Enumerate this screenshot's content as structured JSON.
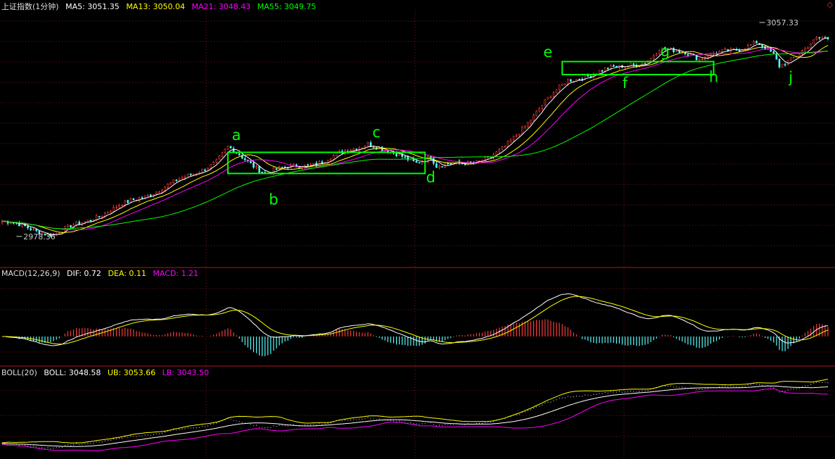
{
  "header_main": {
    "title": "上证指数(1分钟)",
    "ma5": "MA5: 3051.35",
    "ma13": "MA13: 3050.04",
    "ma21": "MA21: 3048.43",
    "ma55": "MA55: 3049.75"
  },
  "header_macd": {
    "title": "MACD(12,26,9)",
    "dif": "DIF: 0.72",
    "dea": "DEA: 0.11",
    "macd": "MACD: 1.21"
  },
  "header_boll": {
    "title": "BOLL(20)",
    "boll": "BOLL: 3048.58",
    "ub": "UB: 3053.66",
    "lb": "LB: 3043.50"
  },
  "corner_icon": "diamond-icon",
  "colors": {
    "background": "#000000",
    "up_candle": "#ff3a3a",
    "down_candle": "#54ffff",
    "ma5": "#ffffff",
    "ma13": "#ffff00",
    "ma21": "#ff00ff",
    "ma55": "#00ff00",
    "annotation": "#00ff00",
    "separator": "#b01818",
    "grid": "#7a1a1a"
  },
  "chart_data": [
    {
      "type": "candlestick",
      "title": "上证指数(1分钟)",
      "ylim": [
        2970,
        3062
      ],
      "price_labels": [
        {
          "text": "3057.33",
          "value": 3057.33,
          "t": 265
        },
        {
          "text": "2978.36",
          "value": 2978.36,
          "t": 5
        }
      ],
      "trend": [
        [
          0,
          2984
        ],
        [
          18,
          2979
        ],
        [
          60,
          2998
        ],
        [
          75,
          3006
        ],
        [
          79,
          3011
        ],
        [
          92,
          3002
        ],
        [
          112,
          3006
        ],
        [
          128,
          3013
        ],
        [
          136,
          3009
        ],
        [
          145,
          3006
        ],
        [
          150,
          3008
        ],
        [
          152,
          3004
        ],
        [
          170,
          3007
        ],
        [
          175,
          3010
        ],
        [
          190,
          3028
        ],
        [
          198,
          3036
        ],
        [
          205,
          3038
        ],
        [
          220,
          3042
        ],
        [
          226,
          3043
        ],
        [
          230,
          3047
        ],
        [
          239,
          3047
        ],
        [
          244,
          3044
        ],
        [
          248,
          3045
        ],
        [
          258,
          3048
        ],
        [
          264,
          3050
        ],
        [
          270,
          3045
        ],
        [
          272,
          3041
        ],
        [
          285,
          3051
        ]
      ],
      "series": [
        {
          "name": "MA5",
          "period": 5
        },
        {
          "name": "MA13",
          "period": 13
        },
        {
          "name": "MA21",
          "period": 21
        },
        {
          "name": "MA55",
          "period": 55
        }
      ],
      "rectangles": [
        {
          "t_start": 79,
          "t_end": 148,
          "price_top": 3009.4,
          "price_bottom": 3001.6
        },
        {
          "t_start": 196,
          "t_end": 249,
          "price_top": 3042.9,
          "price_bottom": 3038.1
        }
      ],
      "annotations": [
        {
          "text": "a",
          "t": 82,
          "value": 3013.9
        },
        {
          "text": "b",
          "t": 95,
          "value": 2990.2
        },
        {
          "text": "c",
          "t": 131,
          "value": 3014.9
        },
        {
          "text": "d",
          "t": 150,
          "value": 2998.3
        },
        {
          "text": "e",
          "t": 191,
          "value": 3044.6
        },
        {
          "text": "f",
          "t": 218,
          "value": 3033.2
        },
        {
          "text": "g",
          "t": 232,
          "value": 3044.8
        },
        {
          "text": "h",
          "t": 249,
          "value": 3035.3
        },
        {
          "text": "j",
          "t": 276,
          "value": 3035.2
        }
      ]
    },
    {
      "type": "macd",
      "title": "MACD(12,26,9)",
      "series": [
        {
          "name": "DIF",
          "fast": 12,
          "slow": 26
        },
        {
          "name": "DEA",
          "signal": 9
        },
        {
          "name": "MACD"
        }
      ]
    },
    {
      "type": "bollinger",
      "title": "BOLL(20)",
      "period": 20,
      "series": [
        {
          "name": "BOLL"
        },
        {
          "name": "UB"
        },
        {
          "name": "LB"
        }
      ]
    }
  ]
}
